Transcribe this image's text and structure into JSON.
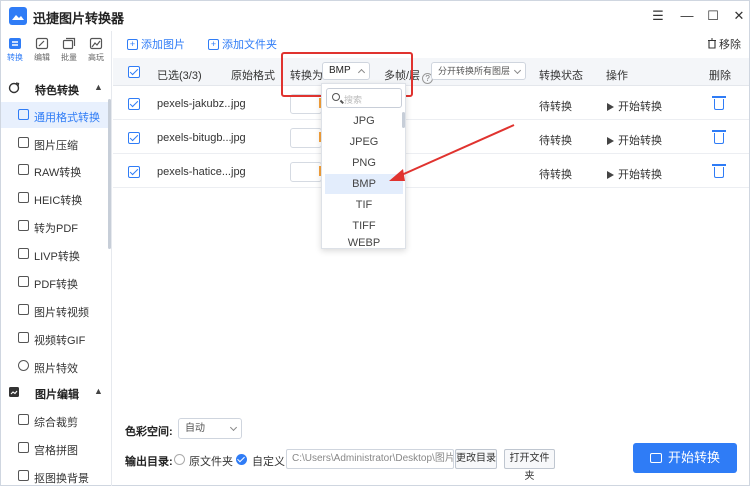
{
  "app": {
    "title": "迅捷图片转换器"
  },
  "window_controls": {
    "menu": "☰",
    "minimize": "—",
    "maximize": "☐",
    "close": "✕"
  },
  "top_tabs": [
    {
      "label": "转换",
      "icon": "convert-icon",
      "active": true
    },
    {
      "label": "编辑",
      "icon": "edit-icon",
      "active": false
    },
    {
      "label": "批量",
      "icon": "batch-icon",
      "active": false
    },
    {
      "label": "高玩",
      "icon": "advanced-icon",
      "active": false
    }
  ],
  "sidebar": {
    "sections": [
      {
        "label": "特色转换",
        "chevron": "▲"
      },
      {
        "label": "图片编辑",
        "chevron": "▲"
      }
    ],
    "items": [
      {
        "label": "通用格式转换",
        "active": true
      },
      {
        "label": "图片压缩"
      },
      {
        "label": "RAW转换"
      },
      {
        "label": "HEIC转换"
      },
      {
        "label": "转为PDF"
      },
      {
        "label": "LIVP转换"
      },
      {
        "label": "PDF转换"
      },
      {
        "label": "图片转视频"
      },
      {
        "label": "视频转GIF"
      },
      {
        "label": "照片特效"
      },
      {
        "label": "综合裁剪"
      },
      {
        "label": "宫格拼图"
      },
      {
        "label": "抠图换背景"
      }
    ]
  },
  "toolbar": {
    "add_image": "添加图片",
    "add_folder": "添加文件夹",
    "remove": "移除"
  },
  "table": {
    "header": {
      "selected": "已选(3/3)",
      "original_format": "原始格式",
      "convert_to": "转换为",
      "convert_value": "BMP",
      "multi_frame": "多帧/层",
      "multi_frame_value": "分开转换所有图层",
      "status": "转换状态",
      "action": "操作",
      "delete": "删除"
    },
    "rows": [
      {
        "name": "pexels-jakubz...",
        "format": "jpg",
        "status": "待转换",
        "action": "开始转换"
      },
      {
        "name": "pexels-bitugb...",
        "format": "jpg",
        "status": "待转换",
        "action": "开始转换"
      },
      {
        "name": "pexels-hatice...",
        "format": "jpg",
        "status": "待转换",
        "action": "开始转换"
      }
    ]
  },
  "dropdown": {
    "search_placeholder": "搜索",
    "options": [
      "JPG",
      "JPEG",
      "PNG",
      "BMP",
      "TIF",
      "TIFF",
      "WEBP"
    ],
    "selected": "BMP"
  },
  "footer": {
    "color_space_label": "色彩空间:",
    "color_space_value": "自动",
    "output_label": "输出目录:",
    "option_original": "原文件夹",
    "option_custom": "自定义",
    "path": "C:\\Users\\Administrator\\Desktop\\图片",
    "change_dir": "更改目录",
    "open_folder": "打开文件夹",
    "start": "开始转换"
  },
  "colors": {
    "accent": "#2f7cf6",
    "highlight": "#e0332f",
    "arrow": "#e0332f"
  }
}
